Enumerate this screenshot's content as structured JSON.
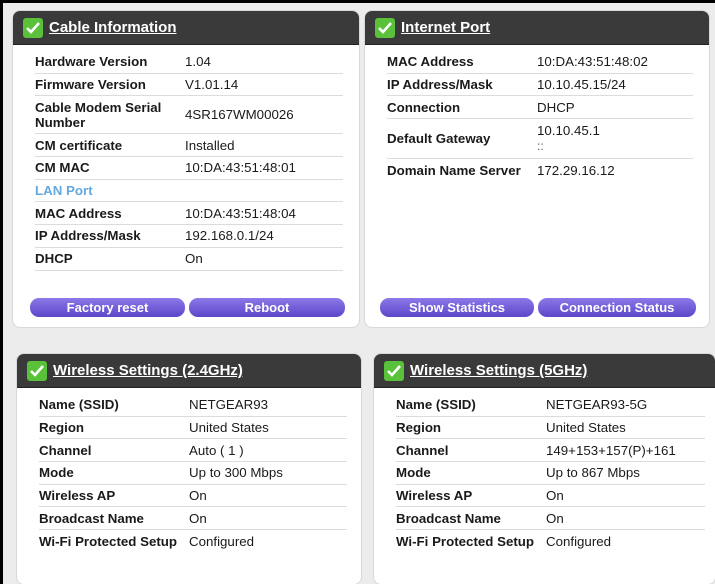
{
  "cable": {
    "title": "Cable Information",
    "rows": [
      {
        "label": "Hardware Version",
        "value": "1.04"
      },
      {
        "label": "Firmware Version",
        "value": "V1.01.14"
      },
      {
        "label": "Cable Modem Serial Number",
        "value": "4SR167WM00026"
      },
      {
        "label": "CM certificate",
        "value": "Installed"
      },
      {
        "label": "CM MAC",
        "value": "10:DA:43:51:48:01"
      }
    ],
    "lan_label": "LAN Port",
    "lan_rows": [
      {
        "label": "MAC Address",
        "value": "10:DA:43:51:48:04"
      },
      {
        "label": "IP Address/Mask",
        "value": "192.168.0.1/24"
      },
      {
        "label": "DHCP",
        "value": "On"
      }
    ],
    "buttons": {
      "factory_reset": "Factory reset",
      "reboot": "Reboot"
    }
  },
  "internet": {
    "title": "Internet Port",
    "rows": [
      {
        "label": "MAC Address",
        "value": "10:DA:43:51:48:02"
      },
      {
        "label": "IP Address/Mask",
        "value": "10.10.45.15/24"
      },
      {
        "label": "Connection",
        "value": "DHCP"
      },
      {
        "label": "Default Gateway",
        "value": "10.10.45.1",
        "value2": "::"
      },
      {
        "label": "Domain Name Server",
        "value": "172.29.16.12"
      }
    ],
    "buttons": {
      "show_statistics": "Show Statistics",
      "connection_status": "Connection Status"
    }
  },
  "wifi24": {
    "title": "Wireless Settings (2.4GHz)",
    "rows": [
      {
        "label": "Name (SSID)",
        "value": "NETGEAR93"
      },
      {
        "label": "Region",
        "value": "United States"
      },
      {
        "label": "Channel",
        "value": "Auto ( 1 )"
      },
      {
        "label": "Mode",
        "value": "Up to 300 Mbps"
      },
      {
        "label": "Wireless AP",
        "value": "On"
      },
      {
        "label": "Broadcast Name",
        "value": "On"
      },
      {
        "label": "Wi-Fi Protected Setup",
        "value": "Configured"
      }
    ]
  },
  "wifi5": {
    "title": "Wireless Settings (5GHz)",
    "rows": [
      {
        "label": "Name (SSID)",
        "value": "NETGEAR93-5G"
      },
      {
        "label": "Region",
        "value": "United States"
      },
      {
        "label": "Channel",
        "value": "149+153+157(P)+161"
      },
      {
        "label": "Mode",
        "value": "Up to 867 Mbps"
      },
      {
        "label": "Wireless AP",
        "value": "On"
      },
      {
        "label": "Broadcast Name",
        "value": "On"
      },
      {
        "label": "Wi-Fi Protected Setup",
        "value": "Configured"
      }
    ]
  },
  "colors": {
    "accent_green": "#59c13a",
    "button_purple": "#6a55d4",
    "header_dark": "#3a3a3a",
    "lan_blue": "#64a8e0"
  },
  "icons": {
    "panel_check": "check-icon"
  }
}
